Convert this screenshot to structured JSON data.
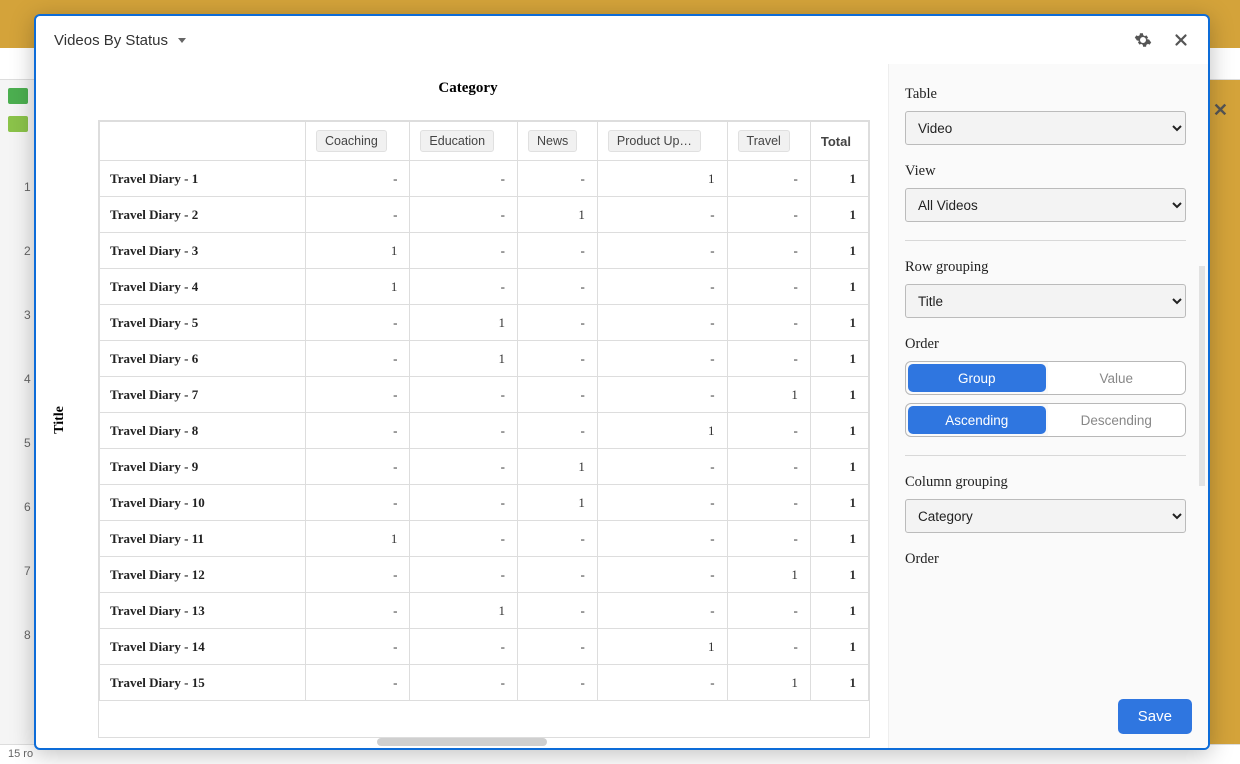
{
  "modal": {
    "title": "Videos By Status"
  },
  "pivot": {
    "col_axis_label": "Category",
    "row_axis_label": "Title",
    "columns": [
      "Coaching",
      "Education",
      "News",
      "Product Up…",
      "Travel",
      "Total"
    ],
    "rows": [
      {
        "label": "Travel Diary - 1",
        "vals": [
          "-",
          "-",
          "-",
          "1",
          "-",
          "1"
        ]
      },
      {
        "label": "Travel Diary - 2",
        "vals": [
          "-",
          "-",
          "1",
          "-",
          "-",
          "1"
        ]
      },
      {
        "label": "Travel Diary - 3",
        "vals": [
          "1",
          "-",
          "-",
          "-",
          "-",
          "1"
        ]
      },
      {
        "label": "Travel Diary - 4",
        "vals": [
          "1",
          "-",
          "-",
          "-",
          "-",
          "1"
        ]
      },
      {
        "label": "Travel Diary - 5",
        "vals": [
          "-",
          "1",
          "-",
          "-",
          "-",
          "1"
        ]
      },
      {
        "label": "Travel Diary - 6",
        "vals": [
          "-",
          "1",
          "-",
          "-",
          "-",
          "1"
        ]
      },
      {
        "label": "Travel Diary - 7",
        "vals": [
          "-",
          "-",
          "-",
          "-",
          "1",
          "1"
        ]
      },
      {
        "label": "Travel Diary - 8",
        "vals": [
          "-",
          "-",
          "-",
          "1",
          "-",
          "1"
        ]
      },
      {
        "label": "Travel Diary - 9",
        "vals": [
          "-",
          "-",
          "1",
          "-",
          "-",
          "1"
        ]
      },
      {
        "label": "Travel Diary - 10",
        "vals": [
          "-",
          "-",
          "1",
          "-",
          "-",
          "1"
        ]
      },
      {
        "label": "Travel Diary - 11",
        "vals": [
          "1",
          "-",
          "-",
          "-",
          "-",
          "1"
        ]
      },
      {
        "label": "Travel Diary - 12",
        "vals": [
          "-",
          "-",
          "-",
          "-",
          "1",
          "1"
        ]
      },
      {
        "label": "Travel Diary - 13",
        "vals": [
          "-",
          "1",
          "-",
          "-",
          "-",
          "1"
        ]
      },
      {
        "label": "Travel Diary - 14",
        "vals": [
          "-",
          "-",
          "-",
          "1",
          "-",
          "1"
        ]
      },
      {
        "label": "Travel Diary - 15",
        "vals": [
          "-",
          "-",
          "-",
          "-",
          "1",
          "1"
        ]
      }
    ]
  },
  "config": {
    "table_label": "Table",
    "table_value": "Video",
    "view_label": "View",
    "view_value": "All Videos",
    "row_group_label": "Row grouping",
    "row_group_value": "Title",
    "order_label": "Order",
    "order_group": "Group",
    "order_value": "Value",
    "order_asc": "Ascending",
    "order_desc": "Descending",
    "col_group_label": "Column grouping",
    "col_group_value": "Category",
    "order2_label": "Order",
    "save": "Save"
  },
  "footer": {
    "rows": "15 ro"
  }
}
